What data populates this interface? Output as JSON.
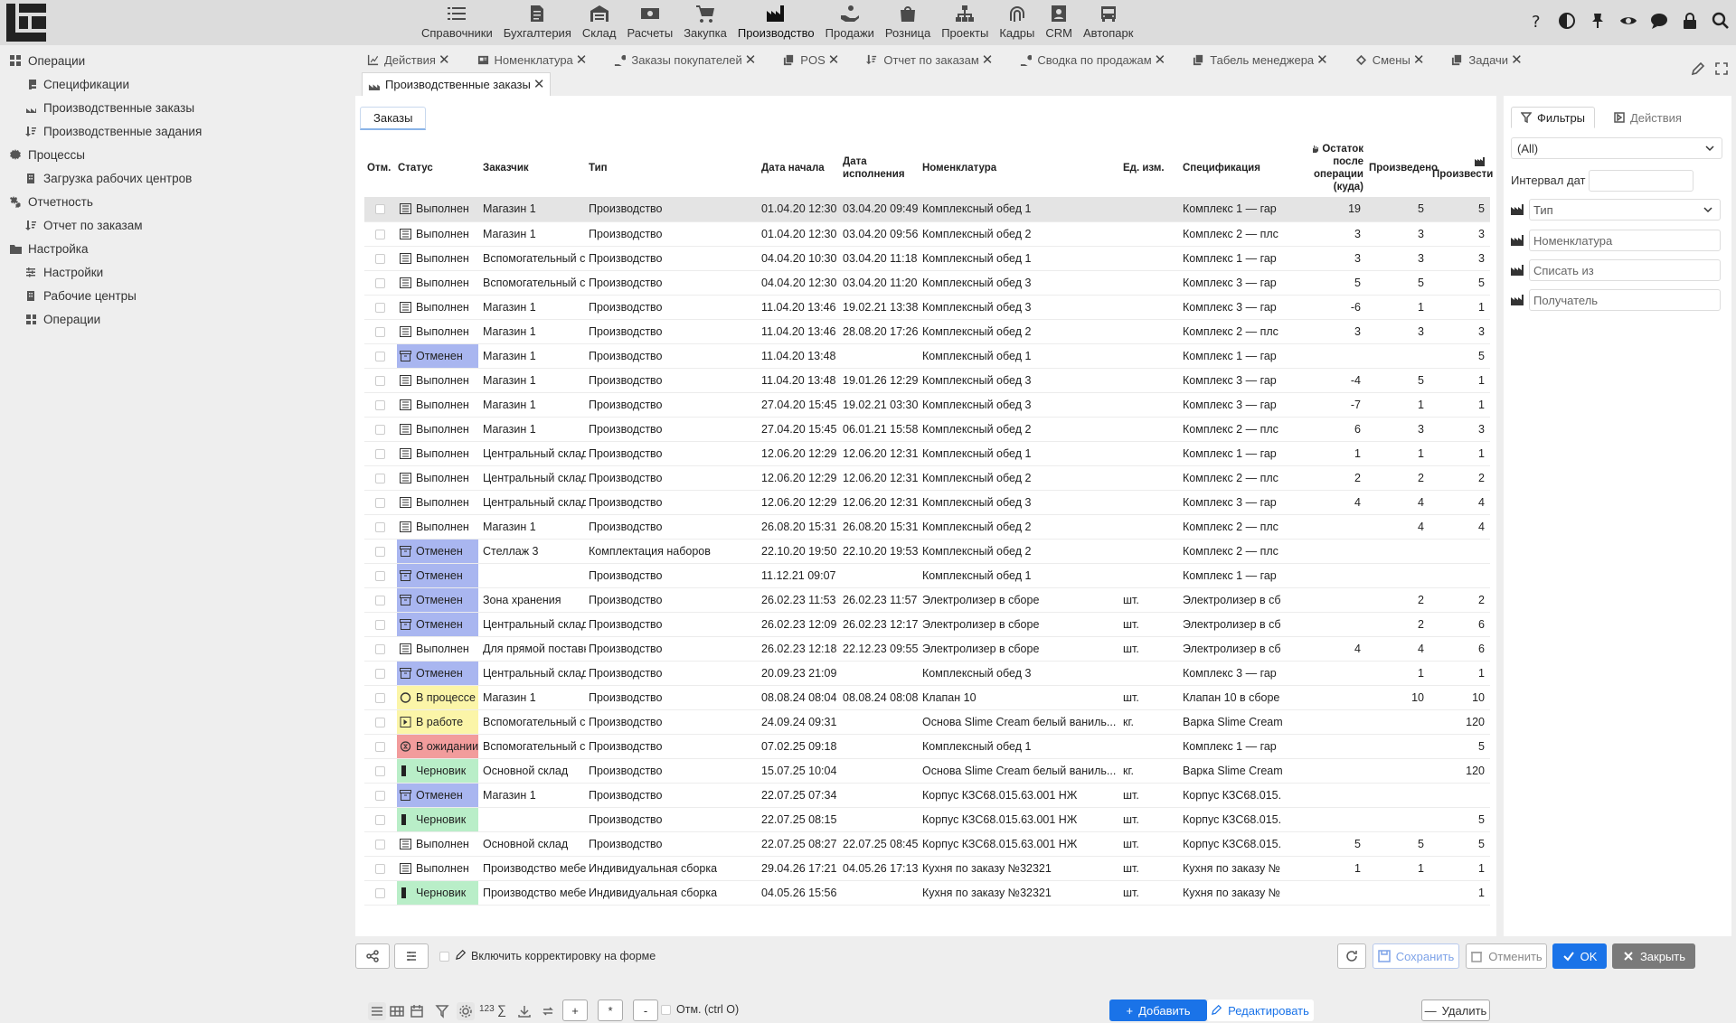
{
  "topmenu": [
    {
      "label": "Справочники",
      "icon": "list-icon"
    },
    {
      "label": "Бухгалтерия",
      "icon": "document-icon"
    },
    {
      "label": "Склад",
      "icon": "warehouse-icon"
    },
    {
      "label": "Расчеты",
      "icon": "money-icon"
    },
    {
      "label": "Закупка",
      "icon": "cart-icon"
    },
    {
      "label": "Производство",
      "icon": "factory-icon",
      "active": true
    },
    {
      "label": "Продажи",
      "icon": "hand-money-icon"
    },
    {
      "label": "Розница",
      "icon": "bag-icon"
    },
    {
      "label": "Проекты",
      "icon": "sitemap-icon"
    },
    {
      "label": "Кадры",
      "icon": "fingerprint-icon"
    },
    {
      "label": "CRM",
      "icon": "contact-card-icon"
    },
    {
      "label": "Автопарк",
      "icon": "bus-icon"
    }
  ],
  "sidebar": {
    "groups": [
      {
        "label": "Операции",
        "icon": "windows-icon",
        "items": [
          {
            "label": "Спецификации",
            "icon": "document-icon"
          },
          {
            "label": "Производственные заказы",
            "icon": "factory-icon"
          },
          {
            "label": "Производственные задания",
            "icon": "sort-icon"
          }
        ]
      },
      {
        "label": "Процессы",
        "icon": "gear-icon",
        "items": [
          {
            "label": "Загрузка рабочих центров",
            "icon": "building-icon"
          }
        ]
      },
      {
        "label": "Отчетность",
        "icon": "gears-icon",
        "items": [
          {
            "label": "Отчет по заказам",
            "icon": "sort-icon"
          }
        ]
      },
      {
        "label": "Настройка",
        "icon": "folder-icon",
        "items": [
          {
            "label": "Настройки",
            "icon": "sliders-icon"
          },
          {
            "label": "Рабочие центры",
            "icon": "building-icon"
          },
          {
            "label": "Операции",
            "icon": "windows-icon"
          }
        ]
      }
    ]
  },
  "tabs_row1": [
    {
      "label": "Действия",
      "icon": "chart-icon"
    },
    {
      "label": "Номенклатура",
      "icon": "card-icon"
    },
    {
      "label": "Заказы покупателей",
      "icon": "hand-money-icon"
    },
    {
      "label": "POS",
      "icon": "copy-icon"
    },
    {
      "label": "Отчет по заказам",
      "icon": "sort-icon"
    },
    {
      "label": "Сводка по продажам",
      "icon": "hand-money-icon"
    },
    {
      "label": "Табель менеджера",
      "icon": "copy-icon"
    },
    {
      "label": "Смены",
      "icon": "diamond-icon"
    },
    {
      "label": "Задачи",
      "icon": "copy-icon"
    }
  ],
  "tabs_row2": [
    {
      "label": "Производственные заказы",
      "icon": "factory-icon"
    }
  ],
  "subtab": "Заказы",
  "columns": [
    "Отм.",
    "Статус",
    "Заказчик",
    "Тип",
    "Дата начала",
    "Дата исполнения",
    "Номенклатура",
    "Ед. изм.",
    "Спецификация",
    "Остаток после операции (куда)",
    "Произведено",
    "Произвести"
  ],
  "rows": [
    [
      "done",
      "Выполнен",
      "Магазин 1",
      "Производство",
      "01.04.20 12:30",
      "03.04.20 09:49",
      "Комплексный обед 1",
      "",
      "Комплекс 1 — гар",
      "19",
      "5",
      "5"
    ],
    [
      "done",
      "Выполнен",
      "Магазин 1",
      "Производство",
      "01.04.20 12:30",
      "03.04.20 09:56",
      "Комплексный обед 2",
      "",
      "Комплекс 2 — плс",
      "3",
      "3",
      "3"
    ],
    [
      "done",
      "Выполнен",
      "Вспомогательный склад",
      "Производство",
      "04.04.20 10:30",
      "03.04.20 11:18",
      "Комплексный обед 1",
      "",
      "Комплекс 1 — гар",
      "3",
      "3",
      "3"
    ],
    [
      "done",
      "Выполнен",
      "Вспомогательный склад",
      "Производство",
      "04.04.20 12:30",
      "03.04.20 11:20",
      "Комплексный обед 3",
      "",
      "Комплекс 3 — гар",
      "5",
      "5",
      "5"
    ],
    [
      "done",
      "Выполнен",
      "Магазин 1",
      "Производство",
      "11.04.20 13:46",
      "19.02.21 13:38",
      "Комплексный обед 3",
      "",
      "Комплекс 3 — гар",
      "-6",
      "1",
      "1"
    ],
    [
      "done",
      "Выполнен",
      "Магазин 1",
      "Производство",
      "11.04.20 13:46",
      "28.08.20 17:26",
      "Комплексный обед 2",
      "",
      "Комплекс 2 — плс",
      "3",
      "3",
      "3"
    ],
    [
      "cancel",
      "Отменен",
      "Магазин 1",
      "Производство",
      "11.04.20 13:48",
      "",
      "Комплексный обед 1",
      "",
      "Комплекс 1 — гар",
      "",
      "",
      "5"
    ],
    [
      "done",
      "Выполнен",
      "Магазин 1",
      "Производство",
      "11.04.20 13:48",
      "19.01.26 12:29",
      "Комплексный обед 3",
      "",
      "Комплекс 3 — гар",
      "-4",
      "5",
      "1"
    ],
    [
      "done",
      "Выполнен",
      "Магазин 1",
      "Производство",
      "27.04.20 15:45",
      "19.02.21 03:30",
      "Комплексный обед 3",
      "",
      "Комплекс 3 — гар",
      "-7",
      "1",
      "1"
    ],
    [
      "done",
      "Выполнен",
      "Магазин 1",
      "Производство",
      "27.04.20 15:45",
      "06.01.21 15:58",
      "Комплексный обед 2",
      "",
      "Комплекс 2 — плс",
      "6",
      "3",
      "3"
    ],
    [
      "done",
      "Выполнен",
      "Центральный склад",
      "Производство",
      "12.06.20 12:29",
      "12.06.20 12:31",
      "Комплексный обед 1",
      "",
      "Комплекс 1 — гар",
      "1",
      "1",
      "1"
    ],
    [
      "done",
      "Выполнен",
      "Центральный склад",
      "Производство",
      "12.06.20 12:29",
      "12.06.20 12:31",
      "Комплексный обед 2",
      "",
      "Комплекс 2 — плс",
      "2",
      "2",
      "2"
    ],
    [
      "done",
      "Выполнен",
      "Центральный склад",
      "Производство",
      "12.06.20 12:29",
      "12.06.20 12:31",
      "Комплексный обед 3",
      "",
      "Комплекс 3 — гар",
      "4",
      "4",
      "4"
    ],
    [
      "done",
      "Выполнен",
      "Магазин 1",
      "Производство",
      "26.08.20 15:31",
      "26.08.20 15:31",
      "Комплексный обед 2",
      "",
      "Комплекс 2 — плс",
      "",
      "4",
      "4"
    ],
    [
      "cancel",
      "Отменен",
      "Стеллаж 3",
      "Комплектация наборов",
      "22.10.20 19:50",
      "22.10.20 19:53",
      "Комплексный обед 2",
      "",
      "Комплекс 2 — плс",
      "",
      "",
      ""
    ],
    [
      "cancel",
      "Отменен",
      "",
      "Производство",
      "11.12.21 09:07",
      "",
      "Комплексный обед 1",
      "",
      "Комплекс 1 — гар",
      "",
      "",
      ""
    ],
    [
      "cancel",
      "Отменен",
      "Зона хранения",
      "Производство",
      "26.02.23 11:53",
      "26.02.23 11:57",
      "Электролизер в сборе",
      "шт.",
      "Электролизер в сб",
      "",
      "2",
      "2"
    ],
    [
      "cancel",
      "Отменен",
      "Центральный склад",
      "Производство",
      "26.02.23 12:09",
      "26.02.23 12:17",
      "Электролизер в сборе",
      "шт.",
      "Электролизер в сб",
      "",
      "2",
      "6"
    ],
    [
      "done",
      "Выполнен",
      "Для прямой поставки",
      "Производство",
      "26.02.23 12:18",
      "22.12.23 09:55",
      "Электролизер в сборе",
      "шт.",
      "Электролизер в сб",
      "4",
      "4",
      "6"
    ],
    [
      "cancel",
      "Отменен",
      "Центральный склад",
      "Производство",
      "20.09.23 21:09",
      "",
      "Комплексный обед 3",
      "",
      "Комплекс 3 — гар",
      "",
      "1",
      "1"
    ],
    [
      "proc",
      "В процессе",
      "Магазин 1",
      "Производство",
      "08.08.24 08:04",
      "08.08.24 08:08",
      "Клапан 10",
      "шт.",
      "Клапан 10 в сборе",
      "",
      "10",
      "10"
    ],
    [
      "work",
      "В работе",
      "Вспомогательный склад",
      "Производство",
      "24.09.24 09:31",
      "",
      "Основа Slime Cream белый ваниль...",
      "кг.",
      "Варка Slime Cream",
      "",
      "",
      "120"
    ],
    [
      "wait",
      "В ожидании",
      "Вспомогательный склад",
      "Производство",
      "07.02.25 09:18",
      "",
      "Комплексный обед 1",
      "",
      "Комплекс 1 — гар",
      "",
      "",
      "5"
    ],
    [
      "draft",
      "Черновик",
      "Основной склад",
      "Производство",
      "15.07.25 10:04",
      "",
      "Основа Slime Cream белый ваниль...",
      "кг.",
      "Варка Slime Cream",
      "",
      "",
      "120"
    ],
    [
      "cancel",
      "Отменен",
      "Магазин 1",
      "Производство",
      "22.07.25 07:34",
      "",
      "Корпус КЗС68.015.63.001 НЖ",
      "шт.",
      "Корпус КЗС68.015.",
      "",
      "",
      ""
    ],
    [
      "draft",
      "Черновик",
      "",
      "Производство",
      "22.07.25 08:15",
      "",
      "Корпус КЗС68.015.63.001 НЖ",
      "шт.",
      "Корпус КЗС68.015.",
      "",
      "",
      "5"
    ],
    [
      "done",
      "Выполнен",
      "Основной склад",
      "Производство",
      "22.07.25 08:27",
      "22.07.25 08:45",
      "Корпус КЗС68.015.63.001 НЖ",
      "шт.",
      "Корпус КЗС68.015.",
      "5",
      "5",
      "5"
    ],
    [
      "done",
      "Выполнен",
      "Производство мебели",
      "Индивидуальная сборка",
      "29.04.26 17:21",
      "04.05.26 17:13",
      "Кухня по заказу №32321",
      "шт.",
      "Кухня по заказу №",
      "1",
      "1",
      "1"
    ],
    [
      "draft",
      "Черновик",
      "Производство мебели",
      "Индивидуальная сборка",
      "04.05.26 15:56",
      "",
      "Кухня по заказу №32321",
      "шт.",
      "Кухня по заказу №",
      "",
      "",
      "1"
    ]
  ],
  "gridbar": {
    "count_label": "123",
    "sum_label": "∑",
    "plus": "+",
    "star": "*",
    "minus": "-",
    "mark_label": "Отм. (ctrl О)",
    "add_label": "Добавить",
    "edit_label": "Редактировать",
    "delete_label": "Удалить"
  },
  "filters": {
    "tab_filters": "Фильтры",
    "tab_actions": "Действия",
    "all_value": "(All)",
    "date_interval": "Интервал дат",
    "type_placeholder": "Тип",
    "nomenclature_placeholder": "Номенклатура",
    "writeoff_placeholder": "Списать из",
    "receiver_placeholder": "Получатель"
  },
  "bottombar": {
    "correction_label": "Включить корректировку на форме",
    "save_label": "Сохранить",
    "cancel_label": "Отменить",
    "ok_label": "OK",
    "close_label": "Закрыть"
  },
  "colors": {
    "accent": "#1a73e8",
    "cancel": "#a9b6f0",
    "progress": "#fbf5a8",
    "wait": "#f29c9c",
    "draft": "#b9eec8"
  }
}
